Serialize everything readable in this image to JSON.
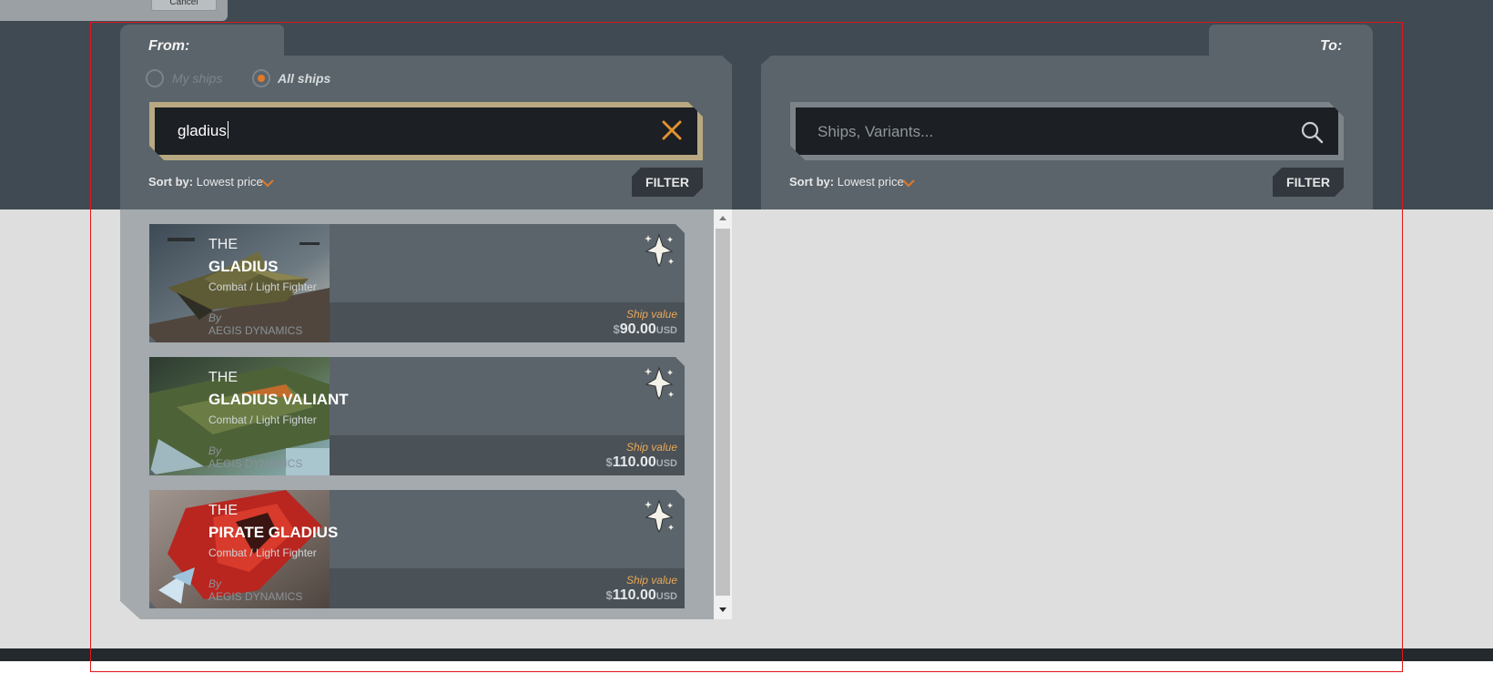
{
  "background_dialog": {
    "cancel_label": "Cancel"
  },
  "from_panel": {
    "label": "From:",
    "radios": [
      {
        "label": "My ships",
        "selected": false
      },
      {
        "label": "All ships",
        "selected": true
      }
    ],
    "search": {
      "value": "gladius"
    },
    "sort": {
      "prefix": "Sort by:",
      "value": "Lowest price"
    },
    "filter_label": "FILTER"
  },
  "to_panel": {
    "label": "To:",
    "search": {
      "placeholder": "Ships, Variants..."
    },
    "sort": {
      "prefix": "Sort by:",
      "value": "Lowest price"
    },
    "filter_label": "FILTER"
  },
  "results": [
    {
      "prefix": "THE",
      "name": "GLADIUS",
      "role": "Combat / Light Fighter",
      "by_label": "By",
      "manufacturer": "AEGIS DYNAMICS",
      "value_label": "Ship value",
      "currency_symbol": "$",
      "price": "90.00",
      "currency": "USD",
      "image": "gladius-ship-image",
      "icon": "light-fighter-icon"
    },
    {
      "prefix": "THE",
      "name": "GLADIUS VALIANT",
      "role": "Combat / Light Fighter",
      "by_label": "By",
      "manufacturer": "AEGIS DYNAMICS",
      "value_label": "Ship value",
      "currency_symbol": "$",
      "price": "110.00",
      "currency": "USD",
      "image": "gladius-valiant-ship-image",
      "icon": "light-fighter-icon"
    },
    {
      "prefix": "THE",
      "name": "PIRATE GLADIUS",
      "role": "Combat / Light Fighter",
      "by_label": "By",
      "manufacturer": "AEGIS DYNAMICS",
      "value_label": "Ship value",
      "currency_symbol": "$",
      "price": "110.00",
      "currency": "USD",
      "image": "pirate-gladius-ship-image",
      "icon": "light-fighter-icon"
    }
  ],
  "colors": {
    "accent_orange": "#e07a2a",
    "search_border_active": "#b8a982",
    "panel": "#5b646b",
    "top_band": "#3f4a52",
    "value_label": "#e8a857",
    "highlight_frame": "#e0161b"
  }
}
